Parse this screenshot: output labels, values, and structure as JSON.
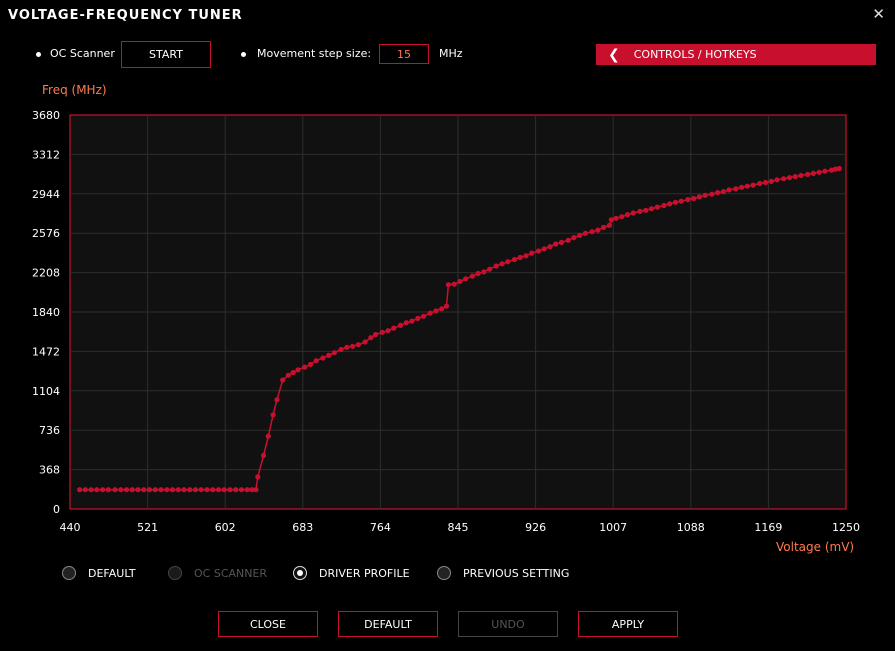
{
  "window": {
    "title": "VOLTAGE-FREQUENCY TUNER",
    "close_glyph": "✕"
  },
  "oc_scanner": {
    "label": "OC Scanner",
    "start_label": "START"
  },
  "step": {
    "label": "Movement step size:",
    "value": "15",
    "unit": "MHz"
  },
  "controls_hotkeys": {
    "label": "CONTROLS / HOTKEYS",
    "icon": "chevron-left-icon"
  },
  "colors": {
    "accent": "#c8102e",
    "axis_title": "#ff7a4d",
    "plot_bg": "#111111",
    "grid": "#2e2e2e"
  },
  "radio_options": [
    {
      "label": "DEFAULT",
      "checked": false,
      "disabled": false
    },
    {
      "label": "OC SCANNER",
      "checked": false,
      "disabled": true
    },
    {
      "label": "DRIVER PROFILE",
      "checked": true,
      "disabled": false
    },
    {
      "label": "PREVIOUS SETTING",
      "checked": false,
      "disabled": false
    }
  ],
  "buttons": {
    "close": "CLOSE",
    "default": "DEFAULT",
    "undo": "UNDO",
    "apply": "APPLY"
  },
  "chart_data": {
    "type": "line",
    "ylabel": "Freq (MHz)",
    "xlabel": "Voltage (mV)",
    "xlim": [
      440,
      1250
    ],
    "ylim": [
      0,
      3680
    ],
    "x_ticks": [
      440,
      521,
      602,
      683,
      764,
      845,
      926,
      1007,
      1088,
      1169,
      1250
    ],
    "y_ticks": [
      0,
      368,
      736,
      1104,
      1472,
      1840,
      2208,
      2576,
      2944,
      3312,
      3680
    ],
    "grid": true,
    "series": [
      {
        "points": [
          [
            450,
            180
          ],
          [
            456,
            180
          ],
          [
            462,
            180
          ],
          [
            468,
            180
          ],
          [
            474,
            180
          ],
          [
            480,
            180
          ],
          [
            487,
            180
          ],
          [
            493,
            180
          ],
          [
            499,
            180
          ],
          [
            505,
            180
          ],
          [
            511,
            180
          ],
          [
            517,
            180
          ],
          [
            523,
            180
          ],
          [
            529,
            180
          ],
          [
            535,
            180
          ],
          [
            541,
            180
          ],
          [
            547,
            180
          ],
          [
            553,
            180
          ],
          [
            559,
            180
          ],
          [
            565,
            180
          ],
          [
            571,
            180
          ],
          [
            577,
            180
          ],
          [
            583,
            180
          ],
          [
            589,
            180
          ],
          [
            595,
            180
          ],
          [
            601,
            180
          ],
          [
            607,
            180
          ],
          [
            613,
            180
          ],
          [
            619,
            180
          ],
          [
            625,
            180
          ],
          [
            630,
            180
          ],
          [
            634,
            180
          ],
          [
            636,
            300
          ],
          [
            642,
            500
          ],
          [
            647,
            680
          ],
          [
            652,
            880
          ],
          [
            656,
            1020
          ],
          [
            662,
            1205
          ],
          [
            668,
            1250
          ],
          [
            673,
            1275
          ],
          [
            678,
            1300
          ],
          [
            685,
            1325
          ],
          [
            691,
            1350
          ],
          [
            697,
            1385
          ],
          [
            704,
            1410
          ],
          [
            710,
            1435
          ],
          [
            716,
            1460
          ],
          [
            723,
            1490
          ],
          [
            729,
            1510
          ],
          [
            735,
            1520
          ],
          [
            741,
            1535
          ],
          [
            748,
            1560
          ],
          [
            754,
            1600
          ],
          [
            759,
            1630
          ],
          [
            766,
            1650
          ],
          [
            772,
            1665
          ],
          [
            778,
            1690
          ],
          [
            785,
            1715
          ],
          [
            791,
            1740
          ],
          [
            797,
            1755
          ],
          [
            803,
            1780
          ],
          [
            809,
            1800
          ],
          [
            816,
            1830
          ],
          [
            822,
            1850
          ],
          [
            828,
            1870
          ],
          [
            833,
            1895
          ],
          [
            835,
            2095
          ],
          [
            841,
            2100
          ],
          [
            847,
            2125
          ],
          [
            853,
            2150
          ],
          [
            860,
            2175
          ],
          [
            866,
            2200
          ],
          [
            872,
            2215
          ],
          [
            878,
            2240
          ],
          [
            885,
            2270
          ],
          [
            891,
            2290
          ],
          [
            897,
            2310
          ],
          [
            904,
            2330
          ],
          [
            910,
            2350
          ],
          [
            916,
            2365
          ],
          [
            922,
            2390
          ],
          [
            929,
            2410
          ],
          [
            935,
            2430
          ],
          [
            941,
            2450
          ],
          [
            947,
            2475
          ],
          [
            953,
            2490
          ],
          [
            960,
            2510
          ],
          [
            966,
            2535
          ],
          [
            972,
            2555
          ],
          [
            978,
            2575
          ],
          [
            985,
            2590
          ],
          [
            991,
            2605
          ],
          [
            997,
            2630
          ],
          [
            1003,
            2650
          ],
          [
            1005,
            2700
          ],
          [
            1010,
            2715
          ],
          [
            1016,
            2730
          ],
          [
            1022,
            2750
          ],
          [
            1028,
            2765
          ],
          [
            1035,
            2780
          ],
          [
            1041,
            2790
          ],
          [
            1047,
            2805
          ],
          [
            1053,
            2820
          ],
          [
            1060,
            2835
          ],
          [
            1066,
            2850
          ],
          [
            1072,
            2865
          ],
          [
            1078,
            2875
          ],
          [
            1085,
            2890
          ],
          [
            1091,
            2900
          ],
          [
            1097,
            2915
          ],
          [
            1103,
            2930
          ],
          [
            1110,
            2940
          ],
          [
            1116,
            2955
          ],
          [
            1122,
            2965
          ],
          [
            1128,
            2980
          ],
          [
            1135,
            2990
          ],
          [
            1141,
            3005
          ],
          [
            1147,
            3015
          ],
          [
            1153,
            3025
          ],
          [
            1160,
            3040
          ],
          [
            1166,
            3050
          ],
          [
            1172,
            3060
          ],
          [
            1178,
            3075
          ],
          [
            1185,
            3085
          ],
          [
            1191,
            3095
          ],
          [
            1197,
            3105
          ],
          [
            1203,
            3115
          ],
          [
            1210,
            3125
          ],
          [
            1216,
            3135
          ],
          [
            1222,
            3145
          ],
          [
            1228,
            3155
          ],
          [
            1235,
            3165
          ],
          [
            1239,
            3175
          ],
          [
            1243,
            3180
          ]
        ]
      }
    ]
  }
}
